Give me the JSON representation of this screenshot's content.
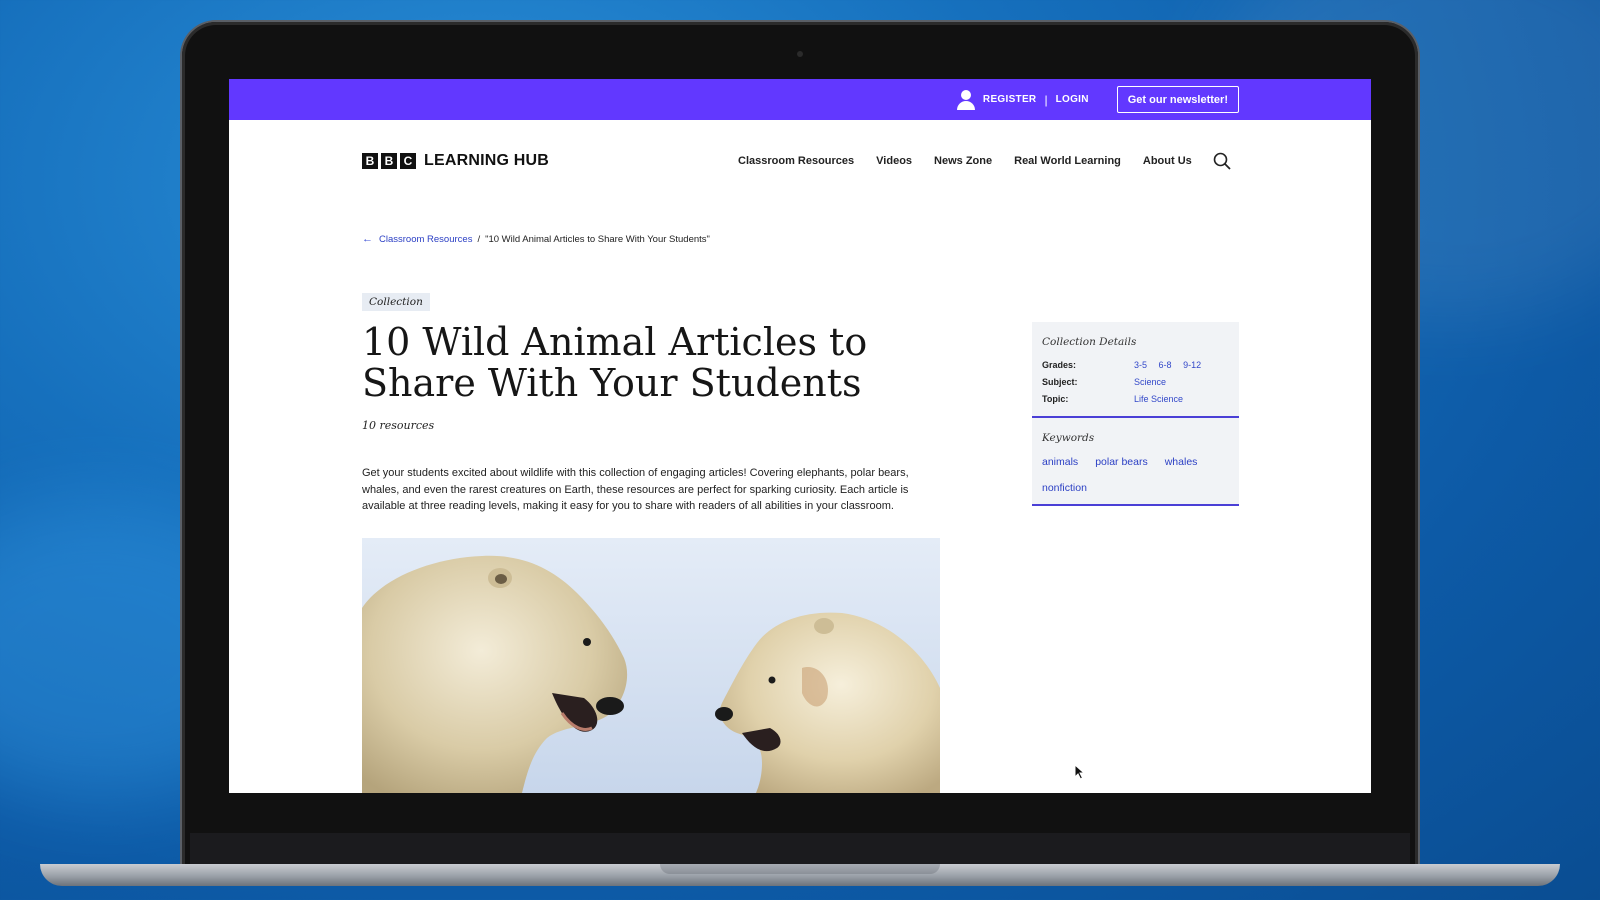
{
  "topbar": {
    "register_label": "REGISTER",
    "separator": "|",
    "login_label": "LOGIN",
    "newsletter_label": "Get our newsletter!",
    "color": "#6238ff"
  },
  "header": {
    "logo_letters": [
      "B",
      "B",
      "C"
    ],
    "logo_text": "LEARNING HUB",
    "nav": [
      {
        "label": "Classroom Resources"
      },
      {
        "label": "Videos"
      },
      {
        "label": "News Zone"
      },
      {
        "label": "Real World Learning"
      },
      {
        "label": "About Us"
      }
    ]
  },
  "breadcrumb": {
    "parent": "Classroom Resources",
    "separator": "/",
    "current": "\"10 Wild Animal Articles to Share With Your Students\""
  },
  "main": {
    "tag": "Collection",
    "title": "10 Wild Animal Articles to Share With Your Students",
    "resources_count": "10 resources",
    "description": "Get your students excited about wildlife with this collection of engaging articles! Covering elephants, polar bears, whales, and even the rarest creatures on Earth, these resources are perfect for sparking curiosity. Each article is available at three reading levels, making it easy for you to share with readers of all abilities in your classroom."
  },
  "sidebar": {
    "details_heading": "Collection Details",
    "grades_label": "Grades:",
    "grades": [
      "3-5",
      "6-8",
      "9-12"
    ],
    "subject_label": "Subject:",
    "subject": "Science",
    "topic_label": "Topic:",
    "topic": "Life Science",
    "keywords_heading": "Keywords",
    "keywords": [
      "animals",
      "polar bears",
      "whales",
      "nonfiction"
    ]
  }
}
